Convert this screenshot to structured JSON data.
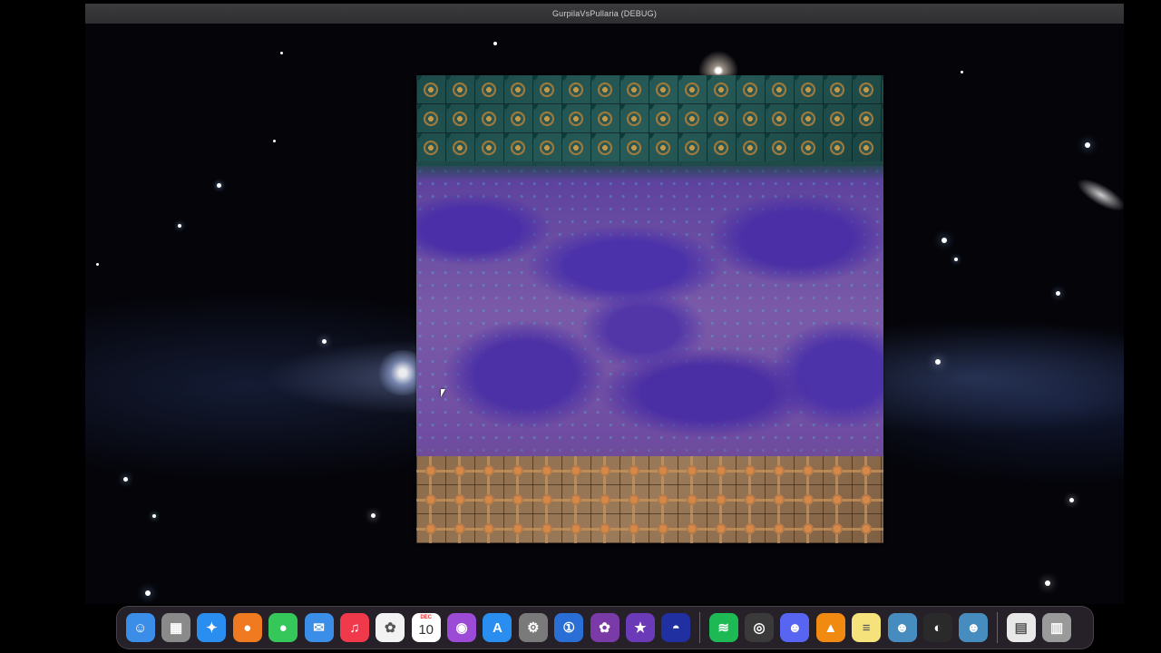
{
  "window": {
    "title": "GurpilaVsPullaria (DEBUG)"
  },
  "game": {
    "board": {
      "top_region": "teal ornate tiles",
      "middle_region": "purple crystal terrain",
      "bottom_region": "tan ornate tiles"
    }
  },
  "dock": {
    "items": [
      {
        "name": "finder-icon",
        "glyph": "☺",
        "color": "#3a8ee8"
      },
      {
        "name": "launchpad-icon",
        "glyph": "▦",
        "color": "#8a8a8a"
      },
      {
        "name": "safari-icon",
        "glyph": "✦",
        "color": "#2a8ef0"
      },
      {
        "name": "firefox-icon",
        "glyph": "●",
        "color": "#f07a20"
      },
      {
        "name": "messages-icon",
        "glyph": "●",
        "color": "#35c759"
      },
      {
        "name": "mail-icon",
        "glyph": "✉",
        "color": "#3a8ee8"
      },
      {
        "name": "music-icon",
        "glyph": "♫",
        "color": "#f0394a"
      },
      {
        "name": "photos-icon",
        "glyph": "✿",
        "color": "#f2f2f2"
      },
      {
        "name": "calendar-icon",
        "month": "DEC",
        "day": "10",
        "color": "#ffffff"
      },
      {
        "name": "podcasts-icon",
        "glyph": "◉",
        "color": "#9b4bd6"
      },
      {
        "name": "app-store-icon",
        "glyph": "A",
        "color": "#2a8ef0"
      },
      {
        "name": "system-settings-icon",
        "glyph": "⚙",
        "color": "#7a7a7a"
      },
      {
        "name": "onepassword-icon",
        "glyph": "①",
        "color": "#2a6fd6"
      },
      {
        "name": "flower-app-icon",
        "glyph": "✿",
        "color": "#7a3aa8"
      },
      {
        "name": "imovie-icon",
        "glyph": "★",
        "color": "#6a3ab8"
      },
      {
        "name": "game-app-icon",
        "glyph": "◓",
        "color": "#2030a0"
      },
      {
        "name": "spotify-icon",
        "glyph": "≋",
        "color": "#1db954"
      },
      {
        "name": "quicktime-icon",
        "glyph": "◎",
        "color": "#3a3a3a"
      },
      {
        "name": "discord-icon",
        "glyph": "☻",
        "color": "#5865f2"
      },
      {
        "name": "vlc-icon",
        "glyph": "▲",
        "color": "#f08a10"
      },
      {
        "name": "notes-icon",
        "glyph": "≡",
        "color": "#f5e27a"
      },
      {
        "name": "godot-icon",
        "glyph": "☻",
        "color": "#478cbf"
      },
      {
        "name": "obs-icon",
        "glyph": "◐",
        "color": "#2a2a2a"
      },
      {
        "name": "godot-running-icon",
        "glyph": "☻",
        "color": "#478cbf"
      },
      {
        "name": "document-icon",
        "glyph": "▤",
        "color": "#e8e8e8"
      },
      {
        "name": "trash-icon",
        "glyph": "▥",
        "color": "#9a9a9a"
      }
    ]
  }
}
